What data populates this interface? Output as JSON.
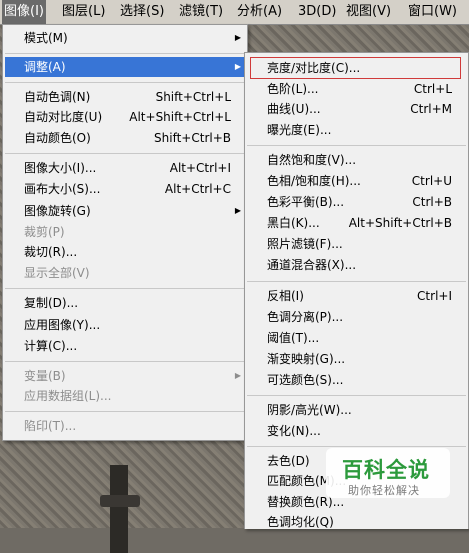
{
  "menubar": {
    "items": [
      {
        "label": "图像(I)",
        "active": true
      },
      {
        "label": "图层(L)",
        "active": false
      },
      {
        "label": "选择(S)",
        "active": false
      },
      {
        "label": "滤镜(T)",
        "active": false
      },
      {
        "label": "分析(A)",
        "active": false
      },
      {
        "label": "3D(D)",
        "active": false
      },
      {
        "label": "视图(V)",
        "active": false
      },
      {
        "label": "窗口(W)",
        "active": false
      }
    ]
  },
  "image_menu": {
    "items": [
      {
        "label": "模式(M)",
        "shortcut": "",
        "submenu": true,
        "disabled": false
      },
      {
        "label": "调整(A)",
        "shortcut": "",
        "submenu": true,
        "disabled": false,
        "highlighted": true
      },
      {
        "label": "自动色调(N)",
        "shortcut": "Shift+Ctrl+L"
      },
      {
        "label": "自动对比度(U)",
        "shortcut": "Alt+Shift+Ctrl+L"
      },
      {
        "label": "自动颜色(O)",
        "shortcut": "Shift+Ctrl+B"
      },
      {
        "label": "图像大小(I)...",
        "shortcut": "Alt+Ctrl+I"
      },
      {
        "label": "画布大小(S)...",
        "shortcut": "Alt+Ctrl+C"
      },
      {
        "label": "图像旋转(G)",
        "shortcut": "",
        "submenu": true
      },
      {
        "label": "裁剪(P)",
        "shortcut": "",
        "disabled": true
      },
      {
        "label": "裁切(R)...",
        "shortcut": ""
      },
      {
        "label": "显示全部(V)",
        "shortcut": "",
        "disabled": true
      },
      {
        "label": "复制(D)...",
        "shortcut": ""
      },
      {
        "label": "应用图像(Y)...",
        "shortcut": ""
      },
      {
        "label": "计算(C)...",
        "shortcut": ""
      },
      {
        "label": "变量(B)",
        "shortcut": "",
        "submenu": true,
        "disabled": true
      },
      {
        "label": "应用数据组(L)...",
        "shortcut": "",
        "disabled": true
      },
      {
        "label": "陷印(T)...",
        "shortcut": "",
        "disabled": true
      }
    ]
  },
  "adjust_menu": {
    "items": [
      {
        "label": "亮度/对比度(C)...",
        "shortcut": "",
        "boxed": true
      },
      {
        "label": "色阶(L)...",
        "shortcut": "Ctrl+L"
      },
      {
        "label": "曲线(U)...",
        "shortcut": "Ctrl+M"
      },
      {
        "label": "曝光度(E)...",
        "shortcut": ""
      },
      {
        "label": "自然饱和度(V)...",
        "shortcut": ""
      },
      {
        "label": "色相/饱和度(H)...",
        "shortcut": "Ctrl+U"
      },
      {
        "label": "色彩平衡(B)...",
        "shortcut": "Ctrl+B"
      },
      {
        "label": "黑白(K)...",
        "shortcut": "Alt+Shift+Ctrl+B"
      },
      {
        "label": "照片滤镜(F)...",
        "shortcut": ""
      },
      {
        "label": "通道混合器(X)...",
        "shortcut": ""
      },
      {
        "label": "反相(I)",
        "shortcut": "Ctrl+I"
      },
      {
        "label": "色调分离(P)...",
        "shortcut": ""
      },
      {
        "label": "阈值(T)...",
        "shortcut": ""
      },
      {
        "label": "渐变映射(G)...",
        "shortcut": ""
      },
      {
        "label": "可选颜色(S)...",
        "shortcut": ""
      },
      {
        "label": "阴影/高光(W)...",
        "shortcut": ""
      },
      {
        "label": "变化(N)...",
        "shortcut": ""
      },
      {
        "label": "去色(D)",
        "shortcut": ""
      },
      {
        "label": "匹配颜色(M)...",
        "shortcut": ""
      },
      {
        "label": "替换颜色(R)...",
        "shortcut": ""
      },
      {
        "label": "色调均化(Q)",
        "shortcut": ""
      }
    ]
  },
  "watermark": {
    "title": "百科全说",
    "subtitle": "助你轻松解决"
  },
  "colors": {
    "menu_bg": "#f0f0f0",
    "highlight": "#3875d6",
    "menubar_active": "#6a6a6a",
    "box": "#d03a3a",
    "watermark_green": "#2c9a3c"
  }
}
